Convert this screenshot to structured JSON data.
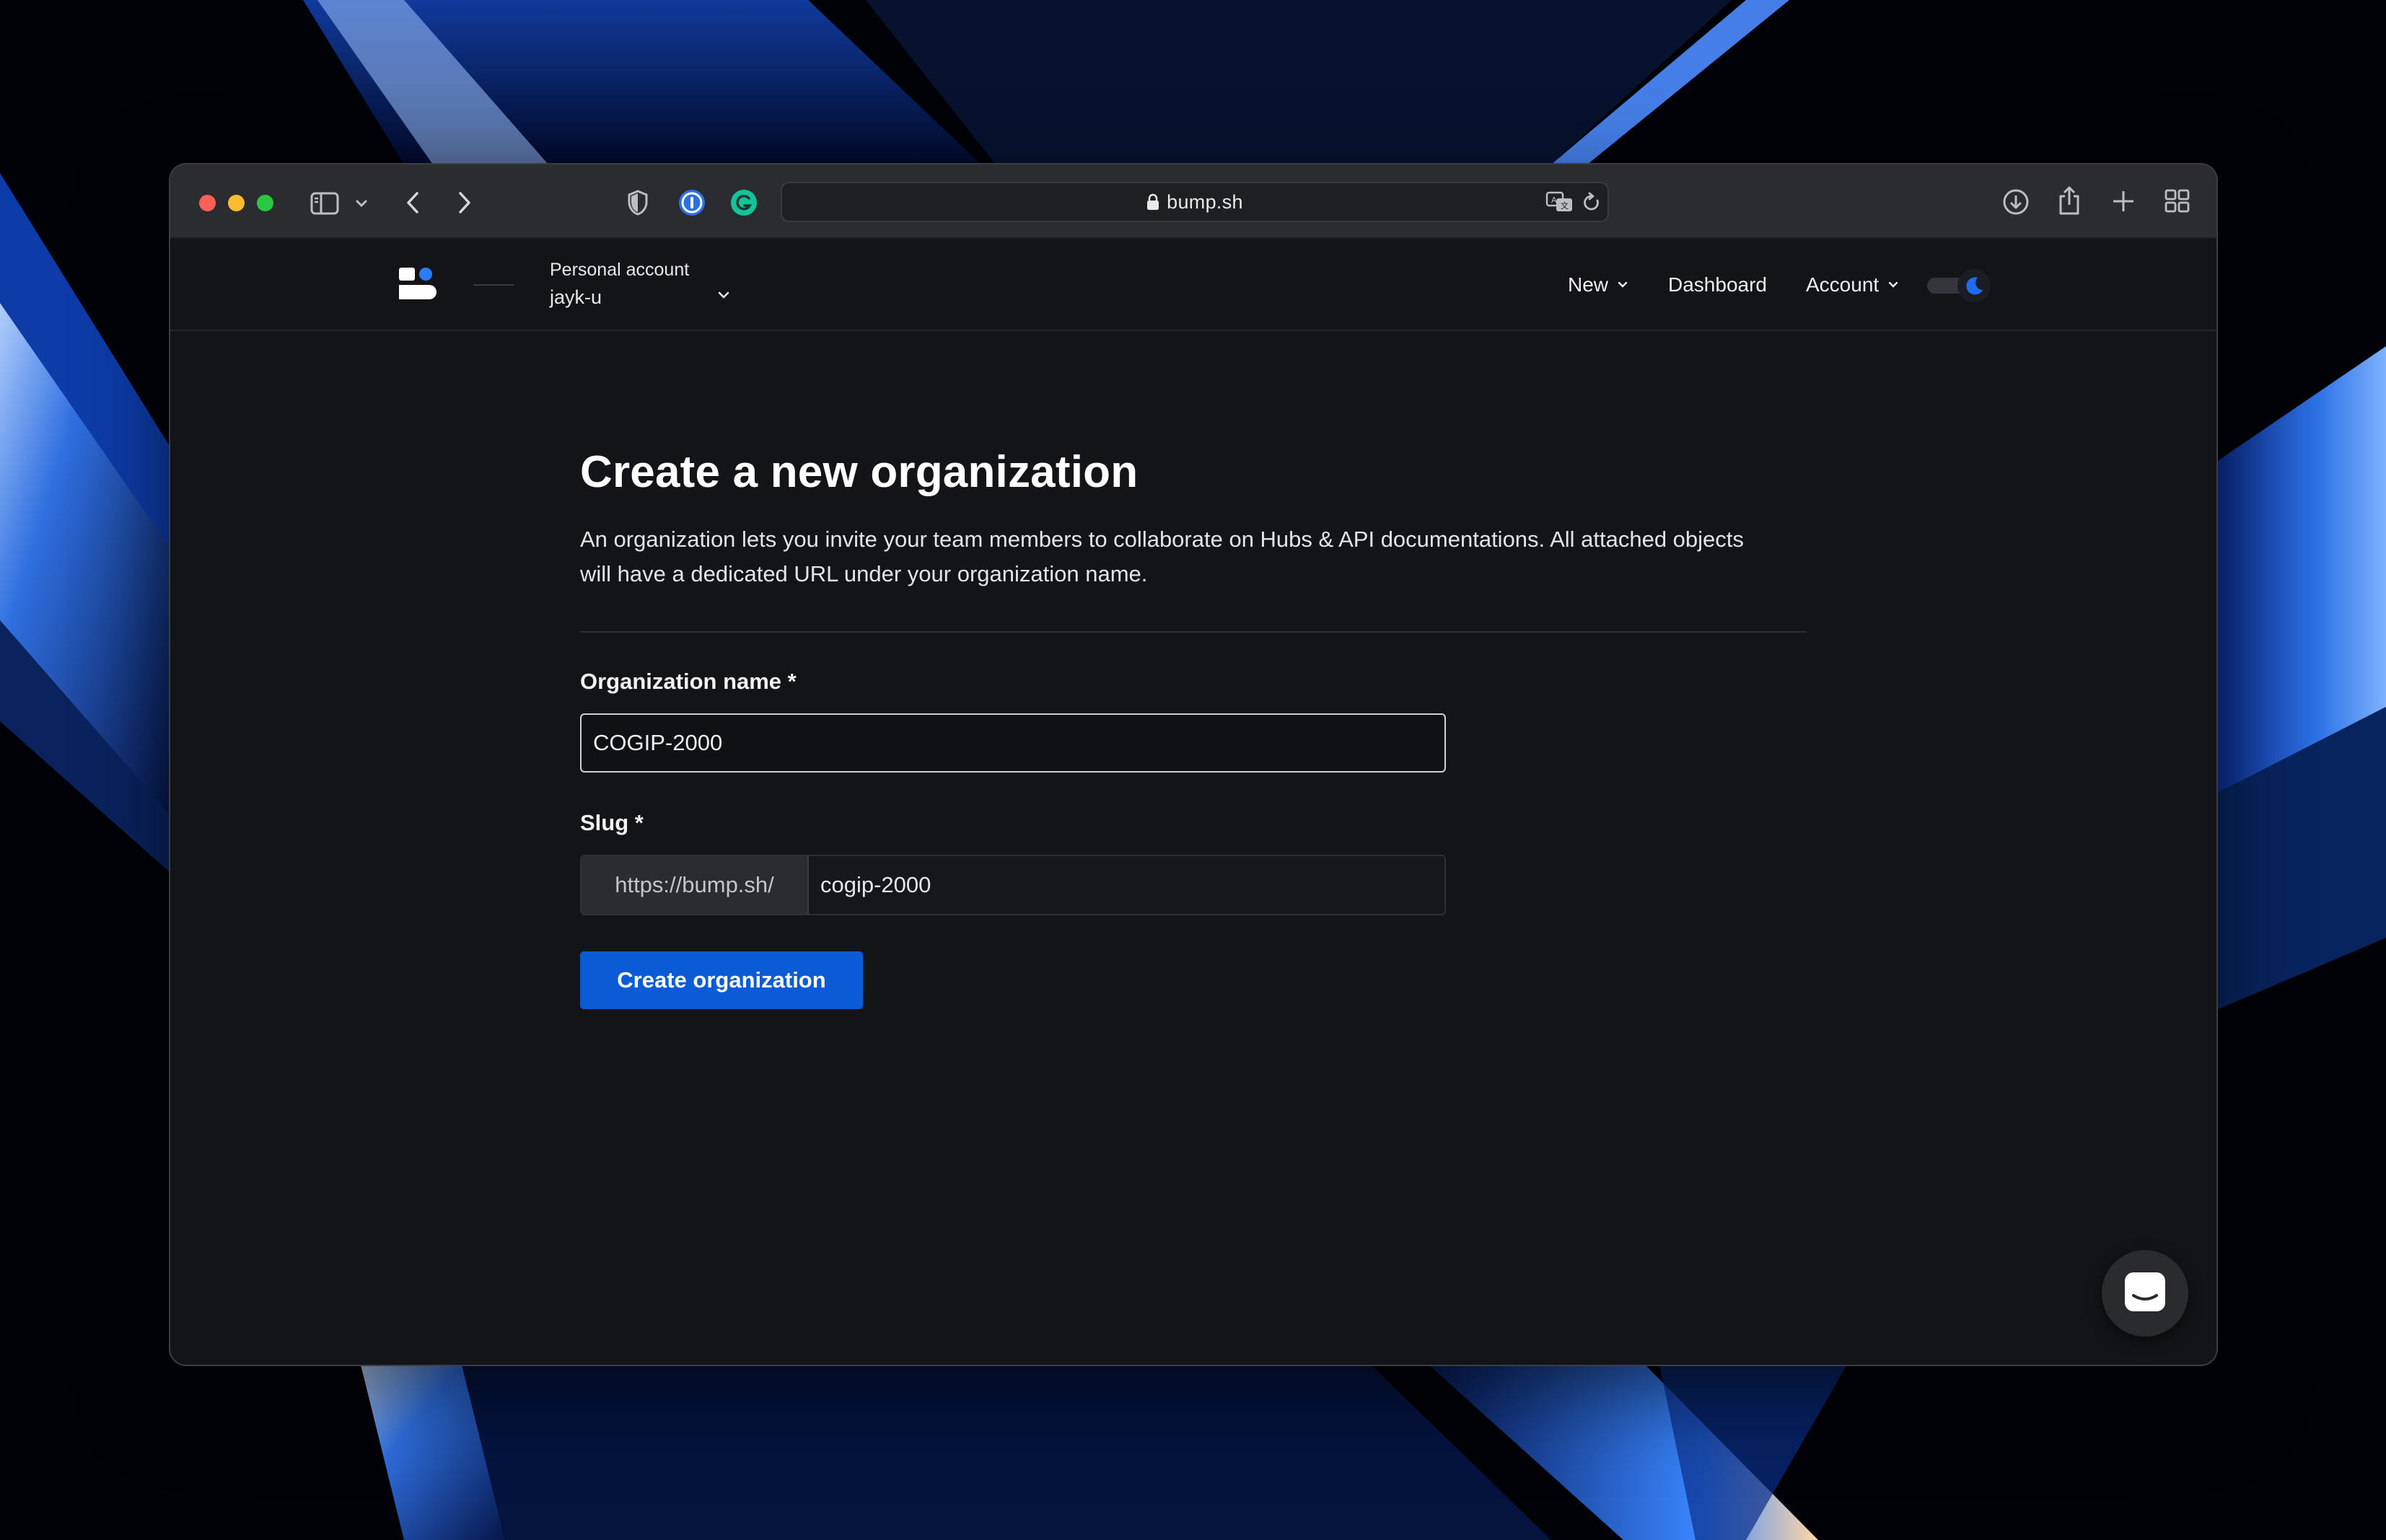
{
  "browser": {
    "url": "bump.sh"
  },
  "header": {
    "account_label": "Personal account",
    "account_name": "jayk-u",
    "nav": {
      "new": "New",
      "dashboard": "Dashboard",
      "account": "Account"
    }
  },
  "page": {
    "title": "Create a new organization",
    "description": "An organization lets you invite your team members to collaborate on Hubs & API documentations. All attached objects will have a dedicated URL under your organization name.",
    "form": {
      "org_name_label": "Organization name *",
      "org_name_value": "COGIP-2000",
      "slug_label": "Slug *",
      "slug_prefix": "https://bump.sh/",
      "slug_value": "cogip-2000",
      "submit_label": "Create organization"
    }
  },
  "colors": {
    "accent": "#0b5bd7",
    "background": "#131417",
    "toolbar": "#2b2c30"
  },
  "icons": {
    "toolbar": [
      "sidebar-icon",
      "chevron-down-icon",
      "back-icon",
      "forward-icon",
      "shield-icon",
      "password-manager-icon",
      "grammarly-icon",
      "lock-icon",
      "translate-icon",
      "reload-icon",
      "download-icon",
      "share-icon",
      "new-tab-icon",
      "tab-overview-icon"
    ],
    "app": [
      "bump-logo",
      "moon-icon",
      "chat-icon"
    ]
  }
}
